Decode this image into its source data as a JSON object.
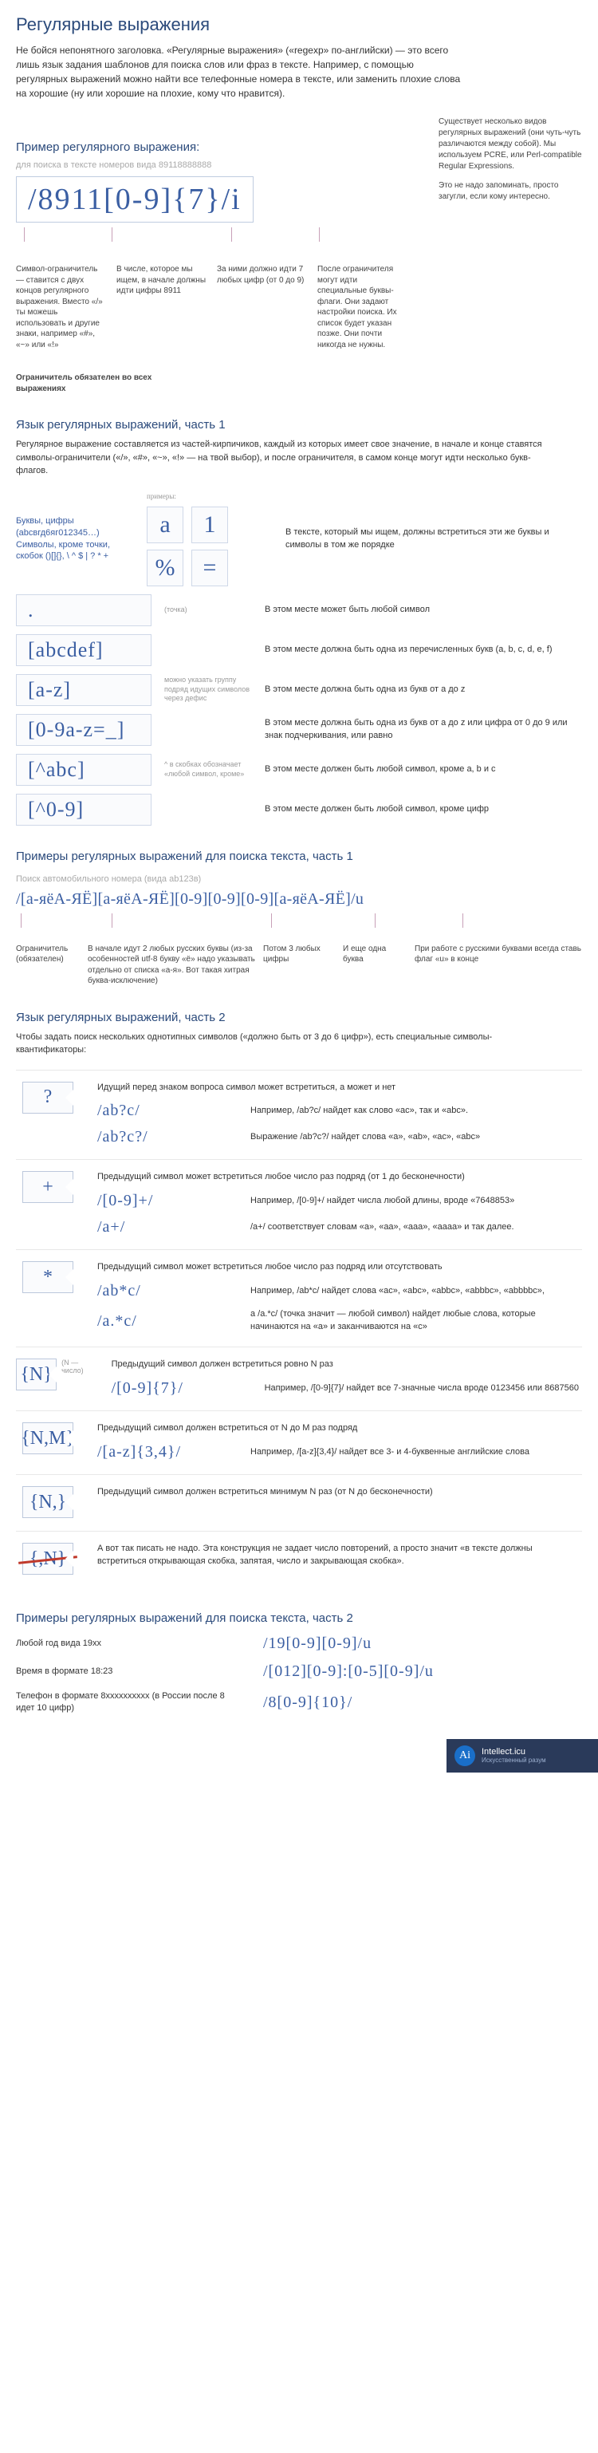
{
  "title": "Регулярные выражения",
  "intro": "Не бойся непонятного заголовка. «Регулярные выражения» («regexp» по-английски) — это всего лишь язык задания шаблонов для поиска слов или фраз в тексте. Например, с помощью регулярных выражений можно найти все телефонные номера в тексте, или заменить плохие слова на хорошие (ну или хорошие на плохие, кому что нравится).",
  "ex1": {
    "heading": "Пример регулярного выражения:",
    "gray_sub": "для  поиска в тексте номеров вида 89118888888",
    "regex": "/8911[0-9]{7}/i",
    "side1": "Существует несколько видов регулярных выражений (они чуть-чуть различаются между собой). Мы используем PCRE, или Perl-compatible Regular Expressions.",
    "side2": "Это не надо запоминать, просто загугли, если кому интересно.",
    "a1": "Символ-ограничитель — ставится с двух концов регулярного выражения. Вместо «/» ты можешь использовать и другие знаки, например «#», «~» или «!»",
    "a2": "В числе, которое мы ищем, в начале должны идти цифры 8911",
    "a3": "За ними должно идти 7 любых цифр (от 0 до 9)",
    "a4": "После ограничителя могут идти специальные буквы-флаги. Они задают настройки поиска. Их список будет указан позже. Они почти никогда не нужны.",
    "limiter": "Ограничитель обязателен во всех выражениях"
  },
  "lang1": {
    "heading": "Язык регулярных выражений, часть 1",
    "intro": "Регулярное выражение составляется из частей-кирпичиков, каждый из которых имеет свое значение, в начале и конце ставятся символы-ограничители («/», «#», «~», «!» — на твой выбор), и после ограничителя, в самом конце могут идти несколько букв-флагов.",
    "row1_left": "Буквы, цифры (abcвгд6яг012345…) Символы, кроме точки, скобок ()[]{}, \\ ^ $ | ? * +",
    "row1_label": "примеры:",
    "row1_s1": "a",
    "row1_s2": "1",
    "row1_s3": "%",
    "row1_s4": "=",
    "row1_desc": "В тексте, который мы ищем, должны встретиться эти же буквы и символы в том же порядке",
    "rows": [
      {
        "box": ".",
        "note": "(точка)",
        "desc": "В этом месте может быть любой символ"
      },
      {
        "box": "[abcdef]",
        "note": "",
        "desc": "В этом месте должна быть одна из перечисленных букв (a, b, c, d, e, f)"
      },
      {
        "box": "[a-z]",
        "note": "можно указать группу подряд идущих символов через дефис",
        "desc": "В этом месте должна быть одна из букв от a до z"
      },
      {
        "box": "[0-9a-z=_]",
        "note": "",
        "desc": "В этом месте должна быть одна из букв от a до z или цифра от 0 до 9 или знак подчеркивания, или равно"
      },
      {
        "box": "[^abc]",
        "note": "^ в скобках обозначает «любой символ, кроме»",
        "desc": "В этом месте должен быть любой символ, кроме a, b и c"
      },
      {
        "box": "[^0-9]",
        "note": "",
        "desc": "В этом месте должен быть любой символ, кроме цифр"
      }
    ]
  },
  "exA": {
    "heading": "Примеры регулярных выражений для поиска текста, часть 1",
    "label": "Поиск автомобильного номера (вида аb123в)",
    "regex": "/[а-яёА-ЯЁ][а-яёА-ЯЁ][0-9][0-9][0-9][а-яёА-ЯЁ]/u",
    "c1": "Ограничитель (обязателен)",
    "c2": "В начале идут 2 любых русских буквы (из-за особенностей utf-8 букву «ё» надо указывать отдельно от списка «а-я». Вот такая хитрая буква-исключение)",
    "c3": "Потом 3 любых цифры",
    "c4": "И еще одна буква",
    "c5": "При работе с русскими буквами всегда ставь флаг «u» в конце"
  },
  "lang2": {
    "heading": "Язык регулярных выражений, часть 2",
    "intro": "Чтобы задать поиск нескольких однотипных символов («должно быть от 3 до 6 цифр»), есть специальные символы-квантификаторы:",
    "q": [
      {
        "sym": "?",
        "head": "Идущий перед знаком вопроса символ может встретиться, а может и нет",
        "pairs": [
          {
            "r": "/ab?c/",
            "d": "Например, /ab?c/ найдет как слово «ac», так и «abc»."
          },
          {
            "r": "/ab?c?/",
            "d": "Выражение /ab?c?/ найдет слова «a», «ab», «ac», «abc»"
          }
        ]
      },
      {
        "sym": "+",
        "head": "Предыдущий символ может встретиться любое число раз подряд (от 1 до бесконечности)",
        "pairs": [
          {
            "r": "/[0-9]+/",
            "d": "Например, /[0-9]+/ найдет числа любой длины, вроде «7648853»"
          },
          {
            "r": "/a+/",
            "d": "/a+/ соответствует словам «a», «aa», «aaa», «aaaa» и так далее."
          }
        ]
      },
      {
        "sym": "*",
        "head": "Предыдущий символ может встретиться любое число раз подряд или отсутствовать",
        "pairs": [
          {
            "r": "/ab*c/",
            "d": "Например, /ab*c/ найдет слова «ac», «abc», «abbc», «abbbc», «abbbbc»,"
          },
          {
            "r": "/a.*c/",
            "d": "а /a.*c/ (точка значит — любой символ) найдет любые слова, которые начинаются на «a» и заканчиваются на «c»"
          }
        ]
      },
      {
        "sym": "{N}",
        "note": "(N — число)",
        "head": "Предыдущий символ должен встретиться ровно N раз",
        "pairs": [
          {
            "r": "/[0-9]{7}/",
            "d": "Например, /[0-9]{7}/ найдет все 7-значные числа вроде 0123456 или 8687560"
          }
        ]
      },
      {
        "sym": "{N,M}",
        "head": "Предыдущий символ должен встретиться от N до M раз подряд",
        "pairs": [
          {
            "r": "/[a-z]{3,4}/",
            "d": "Например, /[a-z]{3,4}/ найдет все 3- и 4-буквенные английские слова"
          }
        ]
      },
      {
        "sym": "{N,}",
        "head": "Предыдущий символ должен встретиться минимум N раз (от N до бесконечности)",
        "pairs": []
      },
      {
        "sym": "{,N}",
        "struck": true,
        "head": "А вот так писать не надо. Эта конструкция не задает число повторений, а просто значит «в тексте должны встретиться открывающая скобка, запятая, число и закрывающая скобка».",
        "pairs": []
      }
    ]
  },
  "exB": {
    "heading": "Примеры регулярных выражений для поиска текста, часть 2",
    "rows": [
      {
        "label": "Любой год вида 19хх",
        "regex": "/19[0-9][0-9]/u"
      },
      {
        "label": "Время в формате 18:23",
        "regex": "/[012][0-9]:[0-5][0-9]/u"
      },
      {
        "label": "Телефон в формате 8хххххххххх (в России после 8 идет 10 цифр)",
        "regex": "/8[0-9]{10}/"
      }
    ]
  },
  "footer": {
    "brand": "Intellect.icu",
    "sub": "Искусственный разум"
  }
}
